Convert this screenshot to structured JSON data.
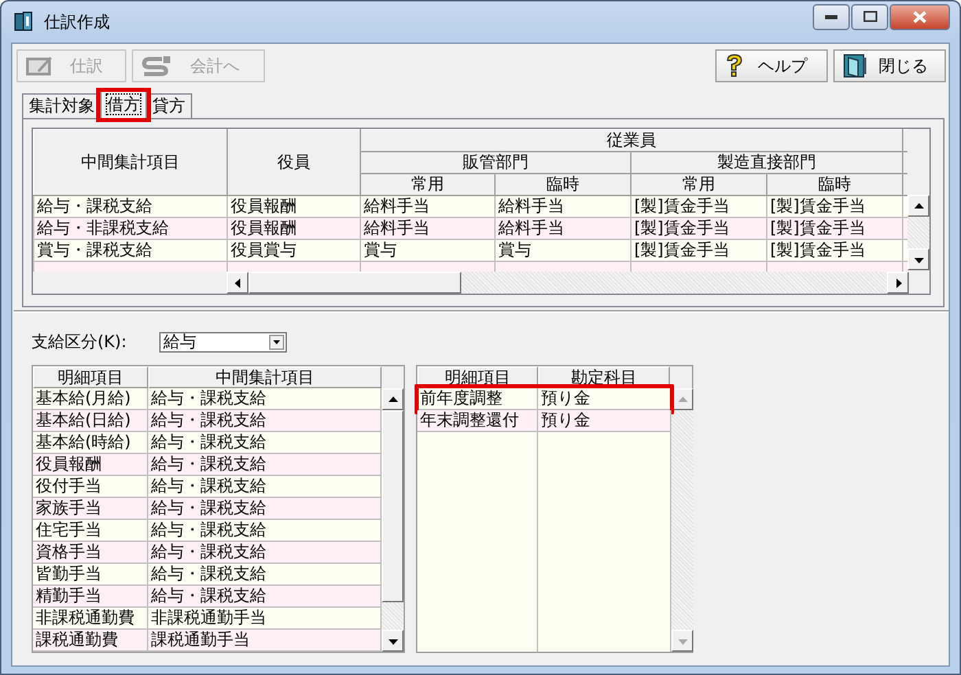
{
  "window": {
    "title": "仕訳作成"
  },
  "toolbar": {
    "left_buttons": [
      {
        "label": "仕訳",
        "kind": "journal",
        "disabled": true
      },
      {
        "label": "会計へ",
        "kind": "export",
        "disabled": true
      }
    ],
    "right_buttons": [
      {
        "label": "ヘルプ",
        "kind": "help",
        "disabled": false
      },
      {
        "label": "閉じる",
        "kind": "close",
        "disabled": false
      }
    ]
  },
  "tabs": [
    {
      "label": "集計対象",
      "selected": false,
      "highlighted": false
    },
    {
      "label": "借方",
      "selected": true,
      "highlighted": true
    },
    {
      "label": "貸方",
      "selected": false,
      "highlighted": false
    }
  ],
  "summary_grid": {
    "columns": [
      "中間集計項目",
      "役員"
    ],
    "group": {
      "label": "従業員",
      "subgroups": [
        {
          "label": "販管部門",
          "columns": [
            "常用",
            "臨時"
          ]
        },
        {
          "label": "製造直接部門",
          "columns": [
            "常用",
            "臨時"
          ]
        }
      ]
    },
    "rows": [
      [
        "給与・課税支給",
        "役員報酬",
        "給料手当",
        "給料手当",
        "[製]賃金手当",
        "[製]賃金手当"
      ],
      [
        "給与・非課税支給",
        "役員報酬",
        "給料手当",
        "給料手当",
        "[製]賃金手当",
        "[製]賃金手当"
      ],
      [
        "賞与・課税支給",
        "役員賞与",
        "賞与",
        "賞与",
        "[製]賃金手当",
        "[製]賃金手当"
      ]
    ]
  },
  "pay_category": {
    "label": "支給区分(K):",
    "value": "給与"
  },
  "detail_grid": {
    "columns": [
      "明細項目",
      "中間集計項目"
    ],
    "rows": [
      {
        "cells": [
          "基本給(月給)",
          "給与・課税支給"
        ]
      },
      {
        "cells": [
          "基本給(日給)",
          "給与・課税支給"
        ]
      },
      {
        "cells": [
          "基本給(時給)",
          "給与・課税支給"
        ]
      },
      {
        "cells": [
          "役員報酬",
          "給与・課税支給"
        ]
      },
      {
        "cells": [
          "役付手当",
          "給与・課税支給"
        ]
      },
      {
        "cells": [
          "家族手当",
          "給与・課税支給"
        ]
      },
      {
        "cells": [
          "住宅手当",
          "給与・課税支給"
        ]
      },
      {
        "cells": [
          "資格手当",
          "給与・課税支給"
        ]
      },
      {
        "cells": [
          "皆勤手当",
          "給与・課税支給"
        ]
      },
      {
        "cells": [
          "精勤手当",
          "給与・課税支給"
        ]
      },
      {
        "cells": [
          "非課税通勤費",
          "非課税通勤手当"
        ]
      },
      {
        "cells": [
          "課税通勤費",
          "課税通勤手当"
        ]
      }
    ]
  },
  "account_grid": {
    "columns": [
      "明細項目",
      "勘定科目"
    ],
    "rows": [
      {
        "cells": [
          "前年度調整",
          "預り金"
        ],
        "highlighted": true
      },
      {
        "cells": [
          "年末調整還付",
          "預り金"
        ],
        "highlighted": false
      }
    ]
  }
}
